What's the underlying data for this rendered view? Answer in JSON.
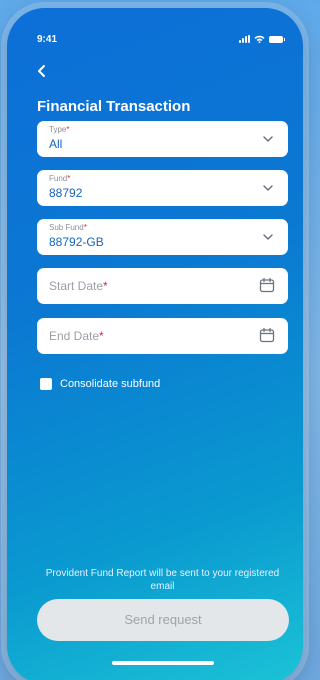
{
  "status_bar": {
    "time": "9:41",
    "icons": [
      "signal-icon",
      "wifi-icon",
      "battery-icon"
    ]
  },
  "header": {
    "back_icon": "chevron-left-icon",
    "title": "Financial Transaction"
  },
  "form": {
    "type": {
      "label": "Type",
      "required_mark": "*",
      "value": "All",
      "icon": "chevron-down-icon"
    },
    "fund": {
      "label": "Fund",
      "required_mark": "*",
      "value": "88792",
      "icon": "chevron-down-icon"
    },
    "sub_fund": {
      "label": "Sub Fund",
      "required_mark": "*",
      "value": "88792-GB",
      "icon": "chevron-down-icon"
    },
    "start_date": {
      "placeholder": "Start Date",
      "required_mark": "*",
      "icon": "calendar-icon"
    },
    "end_date": {
      "placeholder": "End Date",
      "required_mark": "*",
      "icon": "calendar-icon"
    },
    "consolidate": {
      "label": "Consolidate subfund",
      "checked": false
    }
  },
  "footer": {
    "note": "Provident Fund Report will be sent to your registered email",
    "send_label": "Send request"
  },
  "colors": {
    "accent": "#1565c0",
    "required": "#e0243a",
    "button_disabled_bg": "#e4e7ea",
    "button_disabled_text": "#9ea4aa"
  }
}
